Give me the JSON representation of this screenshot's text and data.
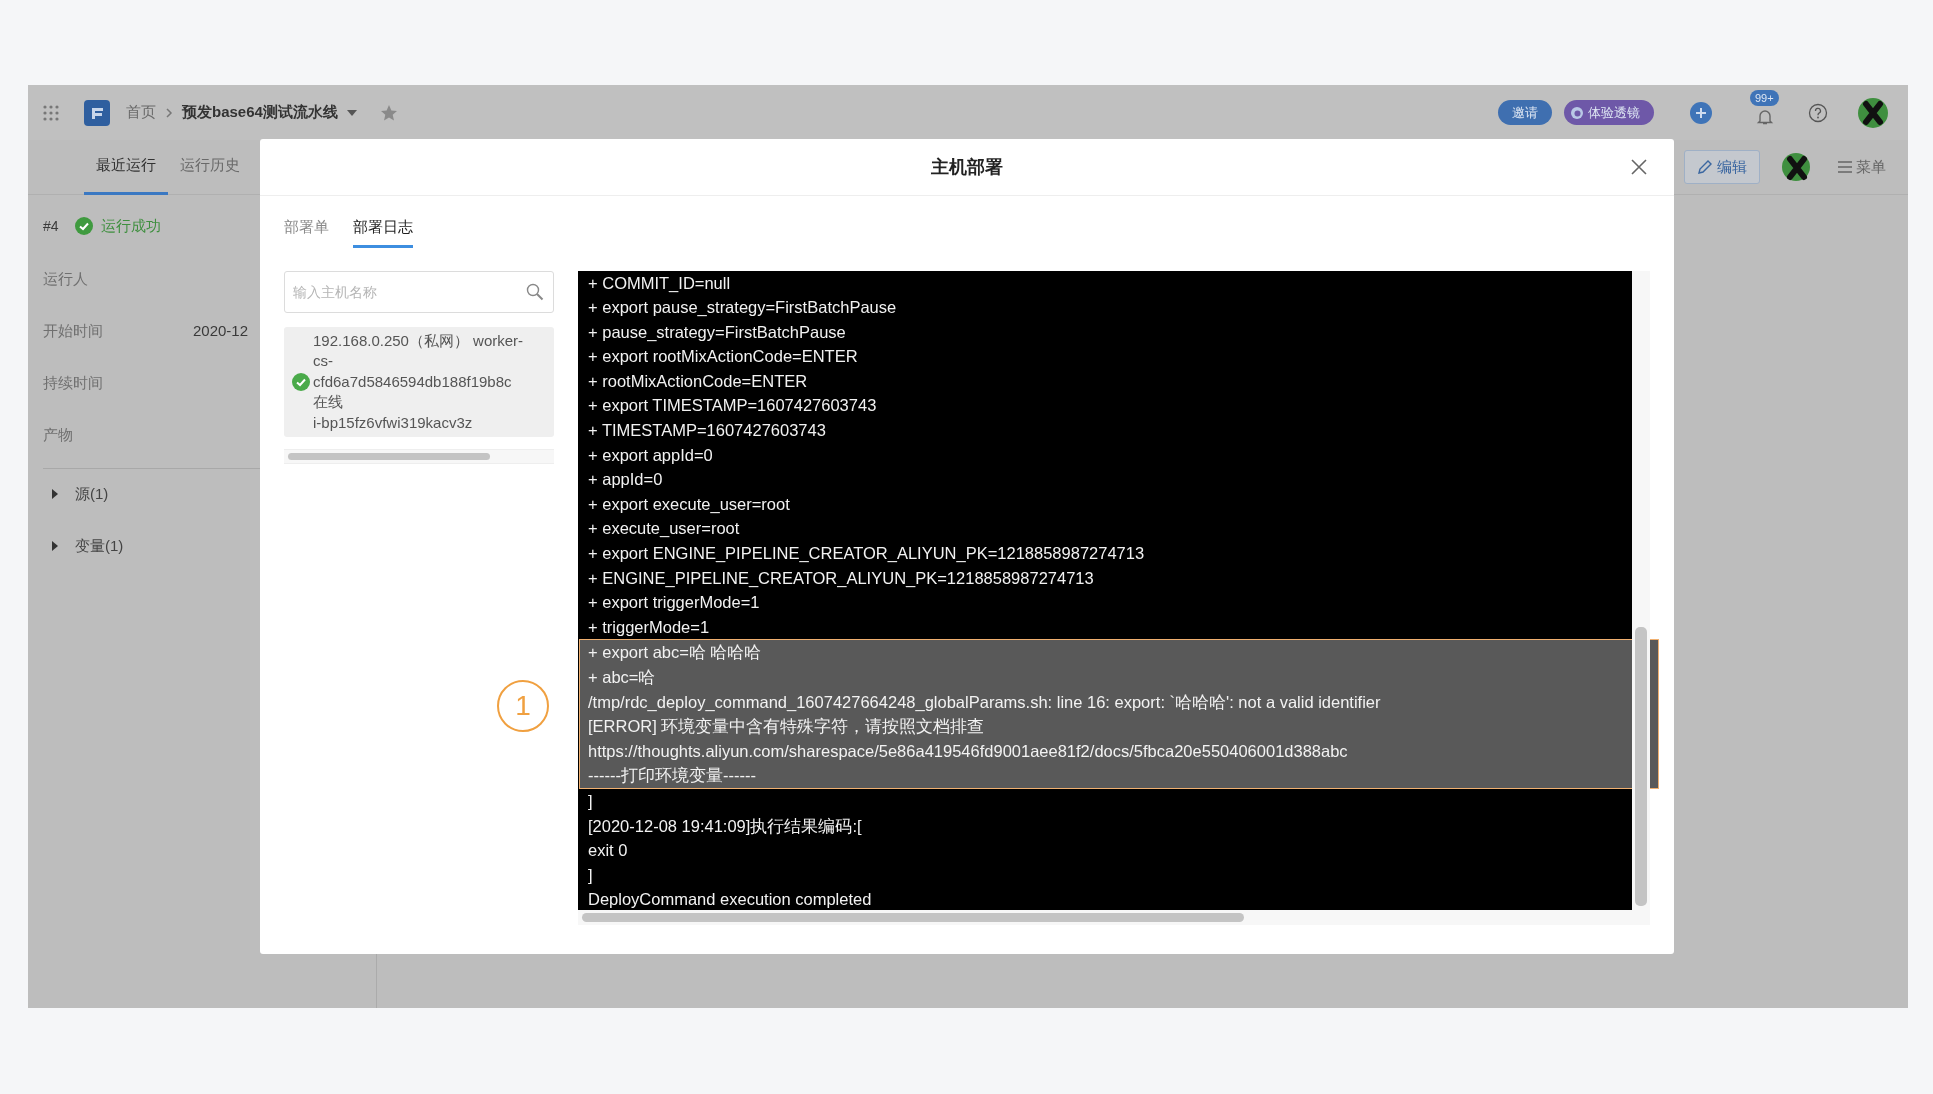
{
  "topbar": {
    "home": "首页",
    "pipeline": "预发base64测试流水线",
    "buttons": [
      {
        "label": "邀请",
        "kind": "invite"
      },
      {
        "label": "体验透镜",
        "kind": "lens"
      }
    ],
    "notifications": "99+"
  },
  "subnav": {
    "tabs": [
      {
        "label": "最近运行",
        "selected": true
      },
      {
        "label": "运行历史",
        "selected": false
      }
    ],
    "edit_button": "编辑",
    "menu_button": "菜单"
  },
  "run": {
    "number": "#4",
    "status": "运行成功",
    "fields": [
      {
        "label": "运行人"
      },
      {
        "label": "开始时间",
        "value": "2020-12"
      },
      {
        "label": "持续时间"
      },
      {
        "label": "产物"
      }
    ],
    "sections": [
      {
        "label": "源(1)",
        "expanded": false
      },
      {
        "label": "变量(1)",
        "expanded": false
      }
    ]
  },
  "modal": {
    "title": "主机部署",
    "tabs": [
      {
        "label": "部署单",
        "selected": false
      },
      {
        "label": "部署日志",
        "selected": true
      }
    ],
    "search": {
      "placeholder": "输入主机名称"
    },
    "hosts": [
      {
        "online": true,
        "lines": [
          "192.168.0.250（私网） worker-",
          "cs-",
          "cfd6a7d5846594db188f19b8c",
          "在线",
          "i-bp15fz6vfwi319kacv3z"
        ]
      }
    ],
    "annotation": "1",
    "log": [
      {
        "text": "+ COMMIT_ID=null",
        "highlighted": false
      },
      {
        "text": "+ export pause_strategy=FirstBatchPause",
        "highlighted": false
      },
      {
        "text": "+ pause_strategy=FirstBatchPause",
        "highlighted": false
      },
      {
        "text": "+ export rootMixActionCode=ENTER",
        "highlighted": false
      },
      {
        "text": "+ rootMixActionCode=ENTER",
        "highlighted": false
      },
      {
        "text": "+ export TIMESTAMP=1607427603743",
        "highlighted": false
      },
      {
        "text": "+ TIMESTAMP=1607427603743",
        "highlighted": false
      },
      {
        "text": "+ export appId=0",
        "highlighted": false
      },
      {
        "text": "+ appId=0",
        "highlighted": false
      },
      {
        "text": "+ export execute_user=root",
        "highlighted": false
      },
      {
        "text": "+ execute_user=root",
        "highlighted": false
      },
      {
        "text": "+ export ENGINE_PIPELINE_CREATOR_ALIYUN_PK=1218858987274713",
        "highlighted": false
      },
      {
        "text": "+ ENGINE_PIPELINE_CREATOR_ALIYUN_PK=1218858987274713",
        "highlighted": false
      },
      {
        "text": "+ export triggerMode=1",
        "highlighted": false
      },
      {
        "text": "+ triggerMode=1",
        "highlighted": false
      },
      {
        "text": "+ export abc=哈 哈哈哈",
        "highlighted": true
      },
      {
        "text": "+ abc=哈",
        "highlighted": true
      },
      {
        "text": "/tmp/rdc_deploy_command_1607427664248_globalParams.sh: line 16: export: `哈哈哈': not a valid identifier",
        "highlighted": true
      },
      {
        "text": "[ERROR] 环境变量中含有特殊字符，请按照文档排查",
        "highlighted": true
      },
      {
        "text": "https://thoughts.aliyun.com/sharespace/5e86a419546fd9001aee81f2/docs/5fbca20e550406001d388abc",
        "highlighted": true
      },
      {
        "text": "------打印环境变量------",
        "highlighted": true
      },
      {
        "text": "]",
        "highlighted": false
      },
      {
        "text": "[2020-12-08 19:41:09]执行结果编码:[",
        "highlighted": false
      },
      {
        "text": "exit 0",
        "highlighted": false
      },
      {
        "text": "]",
        "highlighted": false
      },
      {
        "text": "DeployCommand execution completed",
        "highlighted": false
      }
    ]
  }
}
